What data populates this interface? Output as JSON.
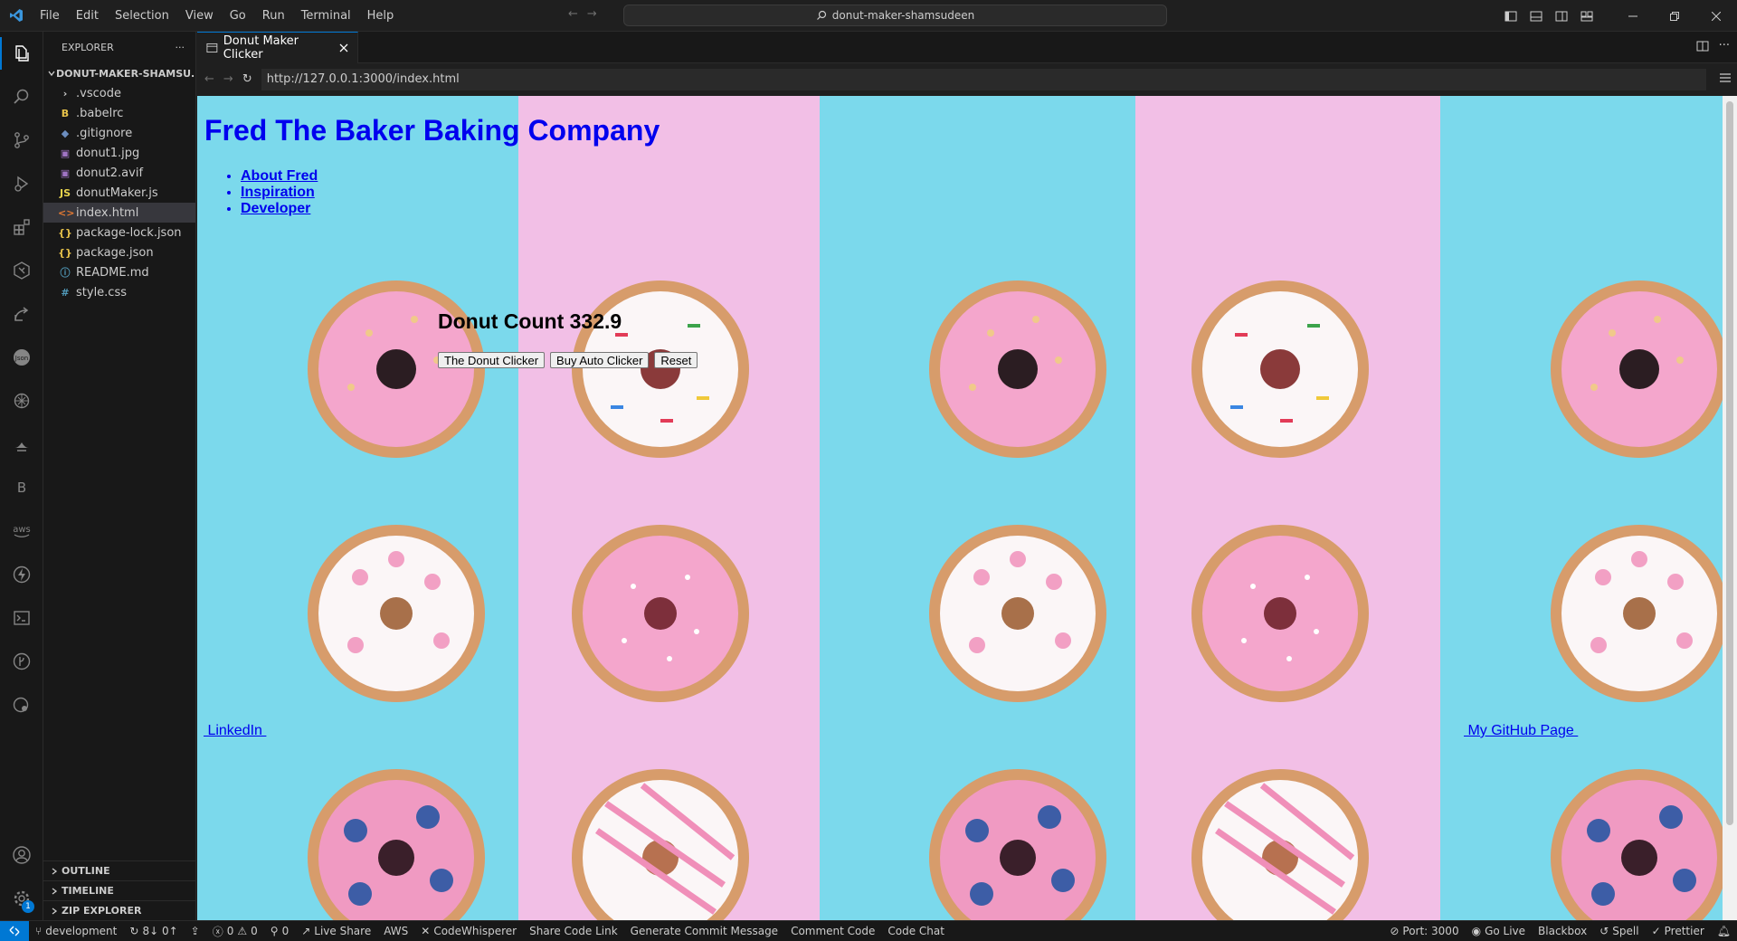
{
  "menu": [
    "File",
    "Edit",
    "Selection",
    "View",
    "Go",
    "Run",
    "Terminal",
    "Help"
  ],
  "command_center": "donut-maker-shamsudeen",
  "explorer": {
    "title": "EXPLORER",
    "folder": "DONUT-MAKER-SHAMSU...",
    "files": [
      {
        "name": ".vscode",
        "icon": "chevron-right-icon",
        "glyph": "›",
        "color": "#cccccc"
      },
      {
        "name": ".babelrc",
        "icon": "babel-icon",
        "glyph": "B",
        "color": "#e8c34a"
      },
      {
        "name": ".gitignore",
        "icon": "git-icon",
        "glyph": "◆",
        "color": "#6c8ebf"
      },
      {
        "name": "donut1.jpg",
        "icon": "image-icon",
        "glyph": "▣",
        "color": "#a074c4"
      },
      {
        "name": "donut2.avif",
        "icon": "image-icon",
        "glyph": "▣",
        "color": "#a074c4"
      },
      {
        "name": "donutMaker.js",
        "icon": "js-icon",
        "glyph": "JS",
        "color": "#e8d44d"
      },
      {
        "name": "index.html",
        "icon": "html-icon",
        "glyph": "<>",
        "color": "#e37933"
      },
      {
        "name": "package-lock.json",
        "icon": "json-icon",
        "glyph": "{}",
        "color": "#e8c34a"
      },
      {
        "name": "package.json",
        "icon": "json-icon",
        "glyph": "{}",
        "color": "#e8c34a"
      },
      {
        "name": "README.md",
        "icon": "info-icon",
        "glyph": "ⓘ",
        "color": "#519aba"
      },
      {
        "name": "style.css",
        "icon": "css-icon",
        "glyph": "#",
        "color": "#519aba"
      }
    ],
    "sections": [
      "OUTLINE",
      "TIMELINE",
      "ZIP EXPLORER"
    ]
  },
  "tab": {
    "label": "Donut Maker Clicker"
  },
  "browser": {
    "url": "http://127.0.0.1:3000/index.html"
  },
  "site": {
    "title": "Fred The Baker Baking Company",
    "nav": [
      "About Fred",
      "Inspiration",
      "Developer"
    ],
    "count_label": "Donut Count 332.9",
    "buttons": {
      "clicker": "The Donut Clicker",
      "auto": "Buy Auto Clicker",
      "reset": "Reset"
    },
    "linkedin": " LinkedIn ",
    "github": " My GitHub Page "
  },
  "status": {
    "branch": "development",
    "sync": "8↓ 0↑",
    "problems_errors": "0",
    "problems_warnings": "0",
    "ports": "0",
    "left_items": [
      "Live Share",
      "AWS",
      "CodeWhisperer",
      "Share Code Link",
      "Generate Commit Message",
      "Comment Code",
      "Code Chat"
    ],
    "right_items": [
      "Port: 3000",
      "Go Live",
      "Blackbox",
      "Spell",
      "Prettier"
    ]
  },
  "colors": {
    "accent": "#0078d4",
    "link": "#0000ee",
    "stripe_blue": "#7bd9ec",
    "stripe_pink": "#f2bfe6"
  }
}
